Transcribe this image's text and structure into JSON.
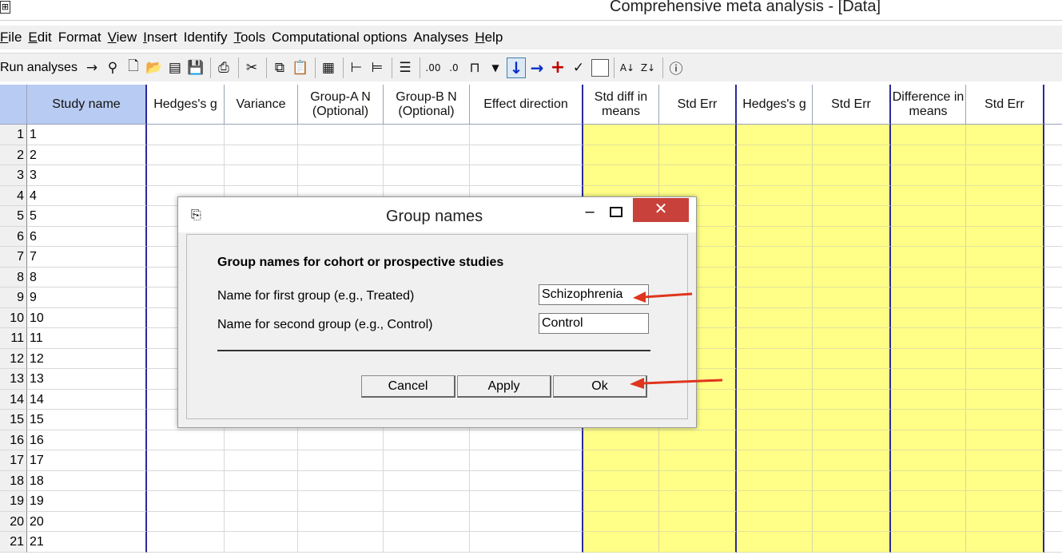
{
  "window": {
    "title": "Comprehensive meta analysis - [Data]",
    "system_icon": "table-icon"
  },
  "menu": {
    "items": [
      {
        "label": "File",
        "u": "F"
      },
      {
        "label": "Edit",
        "u": "E"
      },
      {
        "label": "Format",
        "u": ""
      },
      {
        "label": "View",
        "u": "V"
      },
      {
        "label": "Insert",
        "u": "I"
      },
      {
        "label": "Identify",
        "u": ""
      },
      {
        "label": "Tools",
        "u": "T"
      },
      {
        "label": "Computational options",
        "u": ""
      },
      {
        "label": "Analyses",
        "u": ""
      },
      {
        "label": "Help",
        "u": "H"
      }
    ]
  },
  "toolbar": {
    "run_label": "Run analyses",
    "icons": [
      "run-arrow-icon",
      "wand-icon",
      "new-file-icon",
      "open-folder-icon",
      "open-data-icon",
      "save-icon",
      "print-icon",
      "cut-icon",
      "copy-icon",
      "paste-icon",
      "excel-icon",
      "indent-icon",
      "outdent-icon",
      "list-icon",
      "decimal-increase-icon",
      "decimal-decrease-icon",
      "columns-icon",
      "dropdown-icon",
      "move-down-icon",
      "move-right-icon",
      "add-icon",
      "check-icon",
      "blank-icon",
      "sort-ascending-icon",
      "sort-descending-icon",
      "info-icon"
    ]
  },
  "grid": {
    "columns": [
      {
        "key": "study",
        "label": "Study name"
      },
      {
        "key": "hg",
        "label": "Hedges's g"
      },
      {
        "key": "var",
        "label": "Variance"
      },
      {
        "key": "gan",
        "label": "Group-A N (Optional)"
      },
      {
        "key": "gbn",
        "label": "Group-B N (Optional)"
      },
      {
        "key": "ed",
        "label": "Effect direction"
      },
      {
        "key": "sdm",
        "label": "Std diff in means"
      },
      {
        "key": "se1",
        "label": "Std Err"
      },
      {
        "key": "hg2",
        "label": "Hedges's g"
      },
      {
        "key": "se2",
        "label": "Std Err"
      },
      {
        "key": "dm",
        "label": "Difference in means"
      },
      {
        "key": "se3",
        "label": "Std Err"
      }
    ],
    "rows": [
      {
        "num": "1",
        "study": "1"
      },
      {
        "num": "2",
        "study": "2"
      },
      {
        "num": "3",
        "study": "3"
      },
      {
        "num": "4",
        "study": "4"
      },
      {
        "num": "5",
        "study": "5"
      },
      {
        "num": "6",
        "study": "6"
      },
      {
        "num": "7",
        "study": "7"
      },
      {
        "num": "8",
        "study": "8"
      },
      {
        "num": "9",
        "study": "9"
      },
      {
        "num": "10",
        "study": "10"
      },
      {
        "num": "11",
        "study": "11"
      },
      {
        "num": "12",
        "study": "12"
      },
      {
        "num": "13",
        "study": "13"
      },
      {
        "num": "14",
        "study": "14"
      },
      {
        "num": "15",
        "study": "15"
      },
      {
        "num": "16",
        "study": "16"
      },
      {
        "num": "17",
        "study": "17"
      },
      {
        "num": "18",
        "study": "18"
      },
      {
        "num": "19",
        "study": "19"
      },
      {
        "num": "20",
        "study": "20"
      },
      {
        "num": "21",
        "study": "21"
      }
    ],
    "colors": {
      "computed": "#ffff88",
      "header_selected": "#b8cbf2",
      "divider": "#2a2a9a"
    }
  },
  "dialog": {
    "title": "Group names",
    "heading": "Group names for cohort or prospective studies",
    "first_label": "Name for first group (e.g., Treated)",
    "first_value": "Schizophrenia",
    "second_label": "Name for second group (e.g., Control)",
    "second_value": "Control",
    "cancel_label": "Cancel",
    "apply_label": "Apply",
    "ok_label": "Ok",
    "minimize_glyph": "–",
    "close_glyph": "✕",
    "annotation_color": "#e0351e"
  }
}
